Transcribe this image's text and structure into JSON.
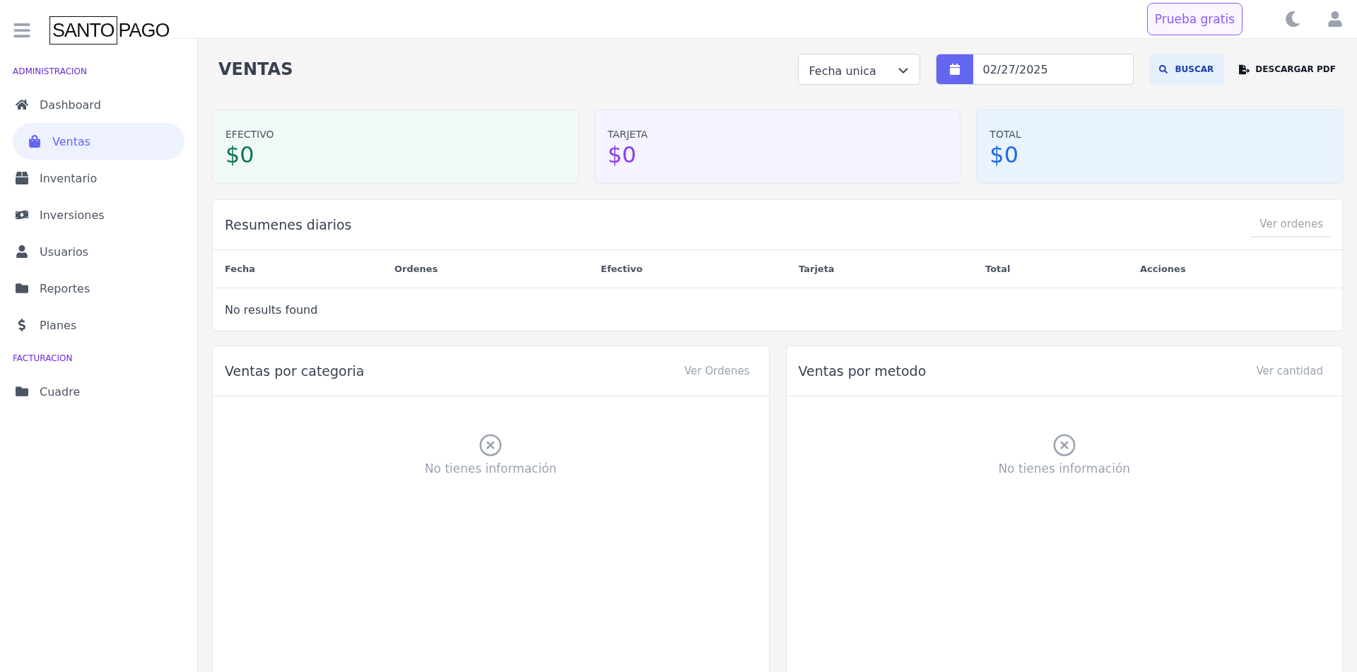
{
  "logo": {
    "boxed": "SANTO",
    "rest": "PAGO"
  },
  "header": {
    "trial_button": "Prueba gratis"
  },
  "sidebar": {
    "sections": [
      {
        "title": "ADMINISTRACION",
        "items": [
          {
            "label": "Dashboard",
            "selected": false
          },
          {
            "label": "Ventas",
            "selected": true
          },
          {
            "label": "Inventario",
            "selected": false
          },
          {
            "label": "Inversiones",
            "selected": false
          },
          {
            "label": "Usuarios",
            "selected": false
          },
          {
            "label": "Reportes",
            "selected": false
          },
          {
            "label": "Planes",
            "selected": false
          }
        ]
      },
      {
        "title": "FACTURACION",
        "items": [
          {
            "label": "Cuadre",
            "selected": false
          }
        ]
      }
    ]
  },
  "page": {
    "title": "VENTAS",
    "date_mode": "Fecha unica",
    "date": "02/27/2025",
    "search_button": "BUSCAR",
    "pdf_button": "DESCARGAR PDF"
  },
  "summary_cards": [
    {
      "label": "EFECTIVO",
      "value": "$0",
      "color": "#0b7a52"
    },
    {
      "label": "TARJETA",
      "value": "$0",
      "color": "#8b3ee8"
    },
    {
      "label": "TOTAL",
      "value": "$0",
      "color": "#1f6ae6"
    }
  ],
  "daily_table": {
    "title": "Resumenes diarios",
    "link": "Ver ordenes",
    "columns": [
      "Fecha",
      "Ordenes",
      "Efectivo",
      "Tarjeta",
      "Total",
      "Acciones"
    ],
    "empty": "No results found"
  },
  "panels": [
    {
      "title": "Ventas por categoria",
      "link": "Ver Ordenes",
      "empty": "No tienes información"
    },
    {
      "title": "Ventas por metodo",
      "link": "Ver cantidad",
      "empty": "No tienes información"
    }
  ]
}
